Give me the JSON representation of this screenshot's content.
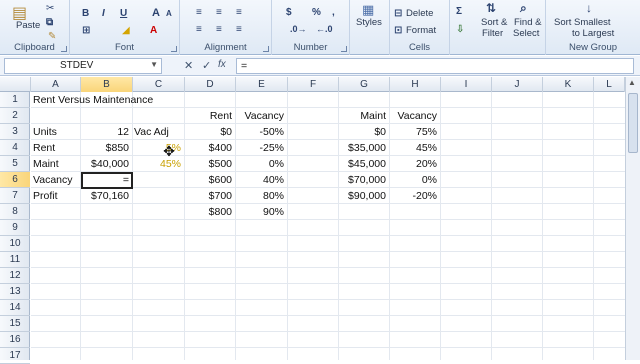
{
  "ribbon": {
    "clipboard": {
      "paste_label": "Paste",
      "group_label": "Clipboard"
    },
    "font": {
      "bold": "B",
      "italic": "I",
      "underline": "U",
      "grow": "A",
      "shrink": "A",
      "group_label": "Font"
    },
    "alignment": {
      "group_label": "Alignment"
    },
    "number": {
      "currency": "$",
      "percent": "%",
      "comma": ",",
      "group_label": "Number"
    },
    "styles": {
      "label": "Styles"
    },
    "cells": {
      "delete_label": "Delete",
      "format_label": "Format",
      "group_label": "Cells"
    },
    "editing": {
      "sort_filter_line1": "Sort &",
      "sort_filter_line2": "Filter",
      "find_select_line1": "Find &",
      "find_select_line2": "Select"
    },
    "new_group": {
      "sort_smallest_line1": "Sort Smallest",
      "sort_smallest_line2": "to Largest",
      "group_label": "New Group"
    }
  },
  "formula_bar": {
    "name_box": "STDEV",
    "cancel": "✕",
    "enter": "✓",
    "fx": "fx",
    "formula": "="
  },
  "columns": [
    "A",
    "B",
    "C",
    "D",
    "E",
    "F",
    "G",
    "H",
    "I",
    "J",
    "K",
    "L"
  ],
  "rows": [
    "1",
    "2",
    "3",
    "4",
    "5",
    "6",
    "7",
    "8",
    "9",
    "10",
    "11",
    "12",
    "13",
    "14",
    "15",
    "16",
    "17"
  ],
  "cells": {
    "A1": "Rent Versus Maintenance",
    "D2": "Rent",
    "E2": "Vacancy",
    "G2": "Maint",
    "H2": "Vacancy",
    "A3": "Units",
    "B3": "12",
    "C3": "Vac Adj",
    "D3": "$0",
    "E3": "-50%",
    "G3": "$0",
    "H3": "75%",
    "A4": "Rent",
    "B4": "$850",
    "C4": "5%",
    "D4": "$400",
    "E4": "-25%",
    "G4": "$35,000",
    "H4": "45%",
    "A5": "Maint",
    "B5": "$40,000",
    "C5": "45%",
    "D5": "$500",
    "E5": "0%",
    "G5": "$45,000",
    "H5": "20%",
    "A6": "Vacancy",
    "B6": "=",
    "D6": "$600",
    "E6": "40%",
    "G6": "$70,000",
    "H6": "0%",
    "A7": "Profit",
    "B7": "$70,160",
    "D7": "$700",
    "E7": "80%",
    "G7": "$90,000",
    "H7": "-20%",
    "D8": "$800",
    "E8": "90%"
  },
  "colors": {
    "ribbon_bg": "#dfe9f5",
    "selected_header": "#f9d57a",
    "grid_line": "#e3e8ef",
    "c_column_text": "#c8a000"
  }
}
